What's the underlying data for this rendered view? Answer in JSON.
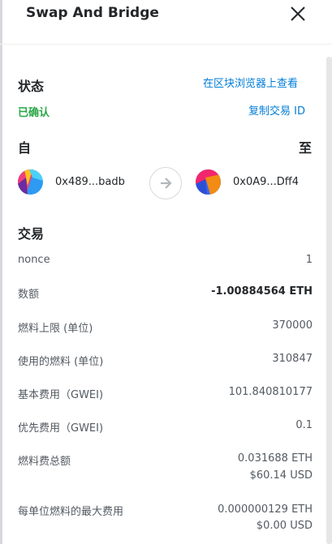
{
  "header": {
    "title": "Swap And Bridge",
    "close_icon": "close-icon"
  },
  "status": {
    "label": "状态",
    "value": "已确认",
    "explorer_link": "在区块浏览器上查看",
    "copy_link": "复制交易 ID"
  },
  "from_to": {
    "from_label": "自",
    "to_label": "至",
    "from_address": "0x489...badb",
    "to_address": "0x0A9...Dff4",
    "arrow_icon": "arrow-right-icon"
  },
  "transaction": {
    "title": "交易",
    "rows": [
      {
        "label": "nonce",
        "value": "1"
      },
      {
        "label": "数额",
        "value": "-1.00884564 ETH"
      },
      {
        "label": "燃料上限 (单位)",
        "value": "370000"
      },
      {
        "label": "使用的燃料 (单位)",
        "value": "310847"
      },
      {
        "label": "基本费用（GWEI)",
        "value": "101.840810177"
      },
      {
        "label": "优先费用（GWEI)",
        "value": "0.1"
      },
      {
        "label": "燃料费总额",
        "value": "0.031688 ETH",
        "value2": "$60.14 USD"
      },
      {
        "label": "每单位燃料的最大费用",
        "value": "0.000000129 ETH",
        "value2": "$0.00 USD"
      }
    ]
  },
  "colors": {
    "accent": "#037dd6",
    "success": "#28a745",
    "text": "#24272a"
  }
}
